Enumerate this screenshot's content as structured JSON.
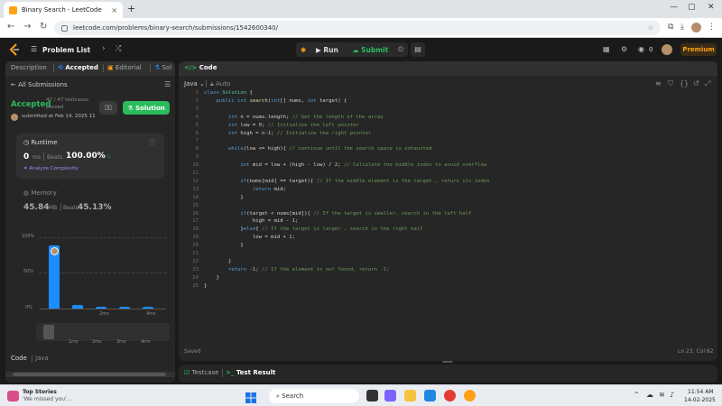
{
  "browser": {
    "tab_title": "Binary Search - LeetCode",
    "tab_close": "×",
    "new_tab": "+",
    "url": "leetcode.com/problems/binary-search/submissions/1542600340/",
    "minimize": "—",
    "maximize": "▢",
    "close": "✕"
  },
  "nav": {
    "problem_list": "Problem List",
    "run": "Run",
    "submit": "Submit",
    "coins": "0",
    "premium": "Premium"
  },
  "left": {
    "tabs": [
      "Description",
      "Accepted",
      "Editorial",
      "Sol"
    ],
    "all_submissions": "All Submissions",
    "status": "Accepted",
    "testcases": "47 / 47 testcases",
    "testcases_2": "passed",
    "submitted": "submitted at Feb 14, 2025 11",
    "solution_button": "Solution",
    "runtime_label": "Runtime",
    "runtime_value": "0",
    "runtime_unit": "ms",
    "beats_label": "Beats",
    "runtime_beats": "100.00%",
    "analyze": "Analyze Complexity",
    "memory_label": "Memory",
    "memory_value": "45.84",
    "memory_unit": "MB",
    "memory_beats_label": "Beats",
    "memory_beats": "45.13%",
    "code_label": "Code",
    "lang_label": "Java"
  },
  "chart_data": {
    "type": "bar",
    "y_ticks": [
      "100%",
      "50%",
      "0%"
    ],
    "ylim": [
      0,
      100
    ],
    "x_ticks": [
      "2ms",
      "4ms"
    ],
    "values": [
      88,
      5,
      3,
      3,
      3
    ],
    "mini_ticks": [
      "1ms",
      "2ms",
      "3ms",
      "4ms"
    ],
    "colors": {
      "bar": "#1a8cff"
    }
  },
  "editor": {
    "title": "Code",
    "language": "Java",
    "auto": "Auto",
    "saved": "Saved",
    "cursor": "Ln 23, Col 62"
  },
  "code_lines": [
    "class Solution {",
    "    public int search(int[] nums, int target) {",
    "",
    "        int n = nums.length; // Get the length of the array",
    "        int low = 0; // Initialize the left pointer",
    "        int high = n-1; // Initialize the right pointer",
    "",
    "        while(low <= high){ // continue until the search space is exhausted",
    "",
    "            int mid = low + (high - low) / 2; // Calculate the middle index to avoid overflow",
    "",
    "            if(nums[mid] == target){ // If the middle element is the target , return its index",
    "                return mid;",
    "            }",
    "",
    "            if(target < nums[mid]){ // If the target is smaller, search in the left half",
    "                high = mid - 1;",
    "            }else{ // If the target is larger , search in the right half",
    "                low = mid + 1;",
    "            }",
    "",
    "        }",
    "        return -1; // If the element is not found, return -1;",
    "    }",
    "}"
  ],
  "bottom": {
    "testcase": "Testcase",
    "test_result": "Test Result"
  },
  "taskbar": {
    "news_title": "Top Stories",
    "news_sub": "'We missed you'...",
    "search": "Search",
    "time": "11:54 AM",
    "date": "14-02-2025"
  }
}
